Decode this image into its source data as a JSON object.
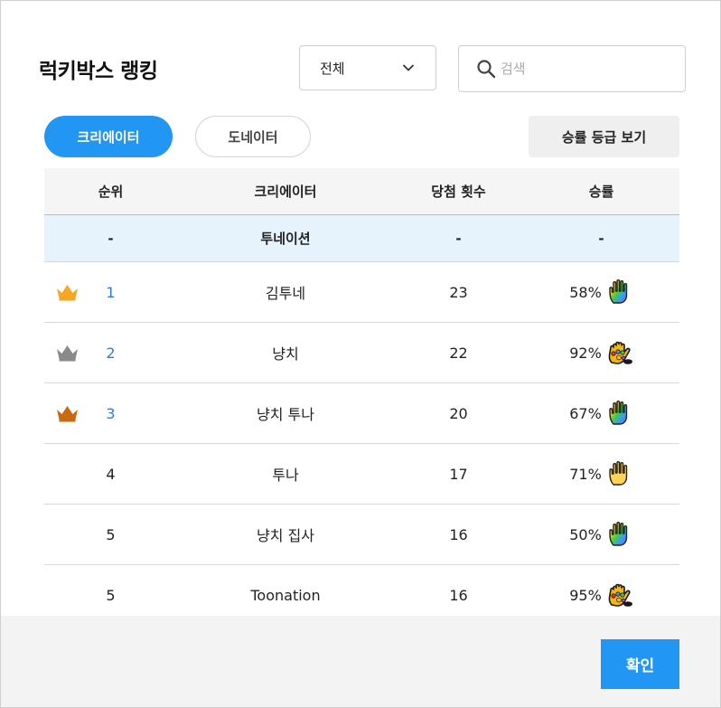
{
  "title": "럭키박스 랭킹",
  "filter": {
    "selected": "전체"
  },
  "search": {
    "placeholder": "검색",
    "value": ""
  },
  "tabs": [
    {
      "label": "크리에이터",
      "active": true
    },
    {
      "label": "도네이터",
      "active": false
    }
  ],
  "grade_button_label": "승률 등급 보기",
  "table": {
    "headers": [
      "순위",
      "크리에이터",
      "당첨 횟수",
      "승률"
    ],
    "self_row": {
      "rank": "-",
      "name": "투네이션",
      "count": "-",
      "rate": "-"
    },
    "rows": [
      {
        "rank": "1",
        "name": "김투네",
        "count": "23",
        "rate": "58%",
        "crown": "gold-crown-icon",
        "grade": "rainbow-hand-icon"
      },
      {
        "rank": "2",
        "name": "냥치",
        "count": "22",
        "rate": "92%",
        "crown": "silver-crown-icon",
        "grade": "golden-gauntlet-icon"
      },
      {
        "rank": "3",
        "name": "냥치 투나",
        "count": "20",
        "rate": "67%",
        "crown": "bronze-crown-icon",
        "grade": "rainbow-hand-icon"
      },
      {
        "rank": "4",
        "name": "투나",
        "count": "17",
        "rate": "71%",
        "crown": "",
        "grade": "yellow-hand-icon"
      },
      {
        "rank": "5",
        "name": "냥치 집사",
        "count": "16",
        "rate": "50%",
        "crown": "",
        "grade": "rainbow-hand-icon"
      },
      {
        "rank": "5",
        "name": "Toonation",
        "count": "16",
        "rate": "95%",
        "crown": "",
        "grade": "golden-gauntlet-icon"
      }
    ]
  },
  "confirm_label": "확인",
  "colors": {
    "accent": "#2196f3",
    "rank_link": "#2a7fd8",
    "gold_crown": "#f5a623",
    "silver_crown": "#8a8a8a",
    "bronze_crown": "#c86b10",
    "self_row_bg": "#e6f3fd"
  }
}
